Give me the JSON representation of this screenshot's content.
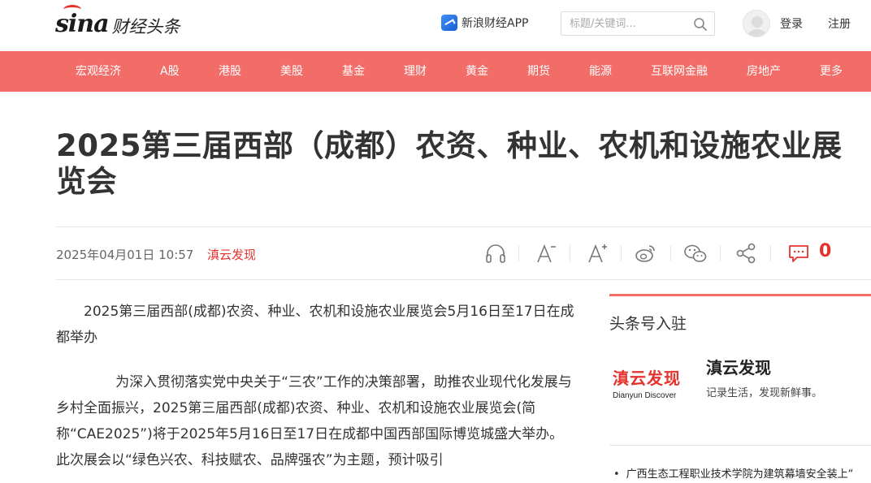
{
  "header": {
    "logo_brand": "sina",
    "logo_text": "财经头条",
    "app_label": "新浪财经APP",
    "search_placeholder": "标题/关键词...",
    "login": "登录",
    "register": "注册"
  },
  "nav": {
    "items": [
      "宏观经济",
      "A股",
      "港股",
      "美股",
      "基金",
      "理财",
      "黄金",
      "期货",
      "能源",
      "互联网金融",
      "房地产",
      "更多"
    ]
  },
  "article": {
    "title": "2025第三届西部（成都）农资、种业、农机和设施农业展览会",
    "date": "2025年04月01日 10:57",
    "source": "滇云发现",
    "comment_count": "0",
    "paragraphs": [
      "2025第三届西部(成都)农资、种业、农机和设施农业展览会5月16日至17日在成都举办",
      "为深入贯彻落实党中央关于“三农”工作的决策部署，助推农业现代化发展与乡村全面振兴，2025第三届西部(成都)农资、种业、农机和设施农业展览会(简称“CAE2025”)将于2025年5月16日至17日在成都中国西部国际博览城盛大举办。此次展会以“绿色兴农、科技赋农、品牌强农”为主题，预计吸引"
    ]
  },
  "toolbar": {
    "icons": [
      "headphones-icon",
      "font-decrease-icon",
      "font-increase-icon",
      "weibo-icon",
      "wechat-icon",
      "share-icon",
      "comment-icon"
    ]
  },
  "sidebar": {
    "section_title": "头条号入驻",
    "logo_main": "滇云发现",
    "logo_sub": "Dianyun Discover",
    "account_name": "滇云发现",
    "account_desc": "记录生活，发现新鲜事。",
    "news": [
      "广西生态工程职业技术学院为建筑幕墙安全装上“"
    ]
  },
  "colors": {
    "nav_bg": "#f26c68",
    "accent_red": "#e5322d",
    "text": "#333333"
  }
}
